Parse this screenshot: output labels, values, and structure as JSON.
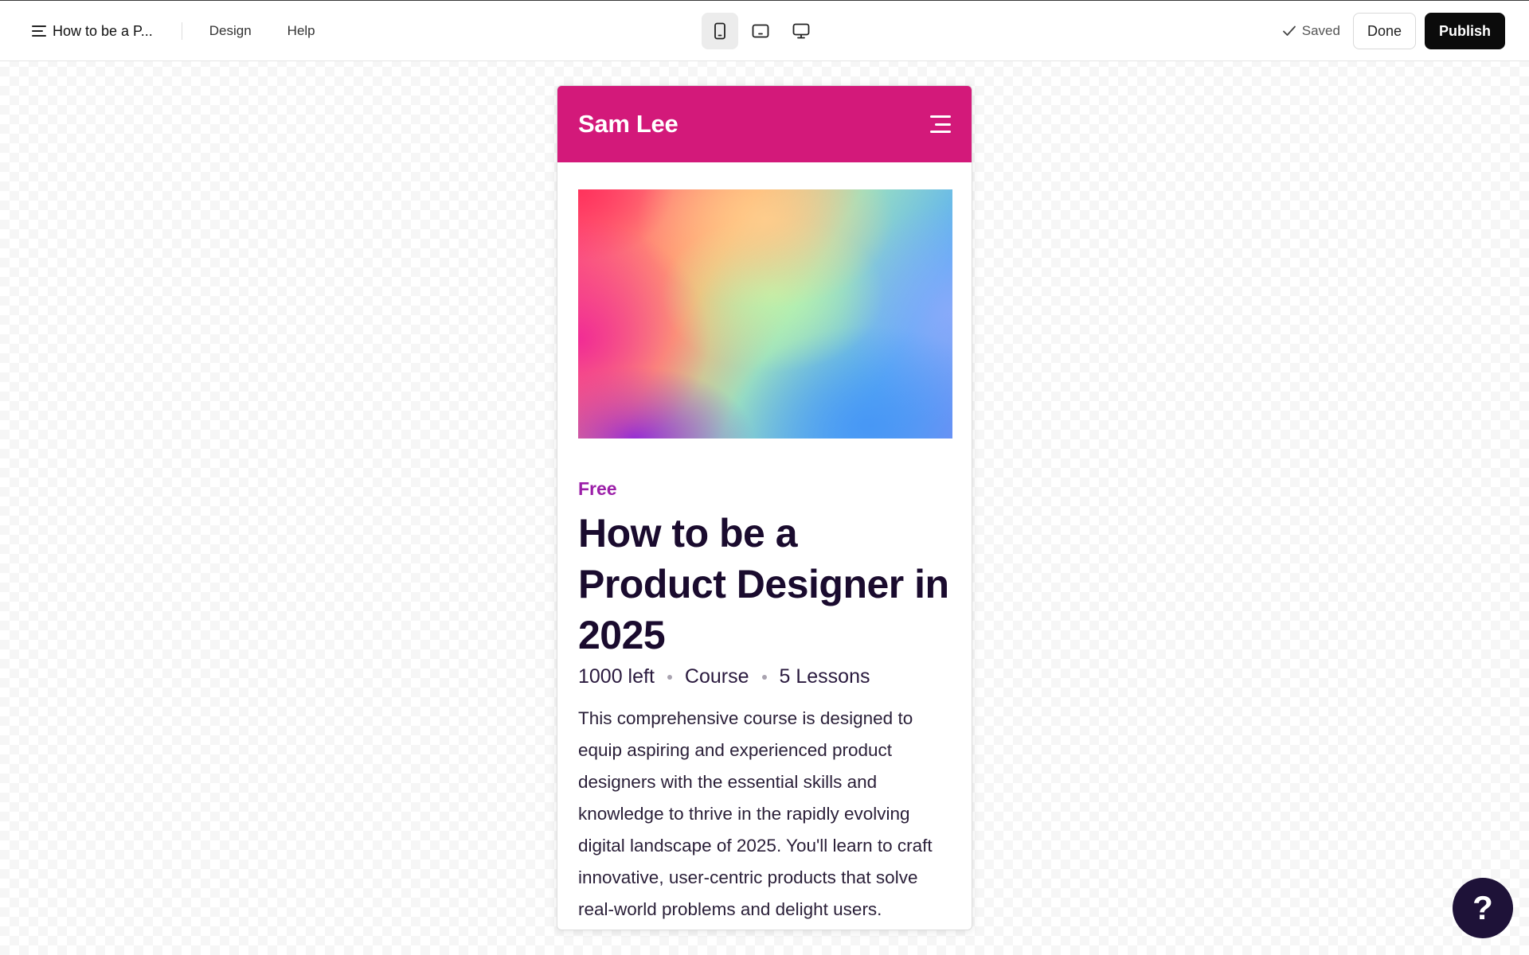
{
  "toolbar": {
    "doc_title": "How to be a P...",
    "nav": {
      "design": "Design",
      "help": "Help"
    },
    "devices": [
      {
        "name": "mobile-view-icon",
        "active": true
      },
      {
        "name": "tablet-view-icon",
        "active": false
      },
      {
        "name": "desktop-view-icon",
        "active": false
      }
    ],
    "saved_label": "Saved",
    "done_label": "Done",
    "publish_label": "Publish"
  },
  "preview": {
    "site_name": "Sam Lee",
    "header_color": "#d3197a",
    "course": {
      "price": "Free",
      "title": "How to be a Product Designer in 2025",
      "meta": [
        "1000 left",
        "Course",
        "5 Lessons"
      ],
      "description": "This comprehensive course is designed to equip aspiring and experienced product designers with the essential skills and knowledge to thrive in the rapidly evolving digital landscape of 2025. You'll learn to craft innovative, user-centric products that solve real-world problems and delight users."
    }
  },
  "help": {
    "label": "?"
  },
  "colors": {
    "accent": "#d3197a",
    "price": "#9b1fa8",
    "publish": "#0b0b0b",
    "help_bubble": "#1e1238"
  }
}
